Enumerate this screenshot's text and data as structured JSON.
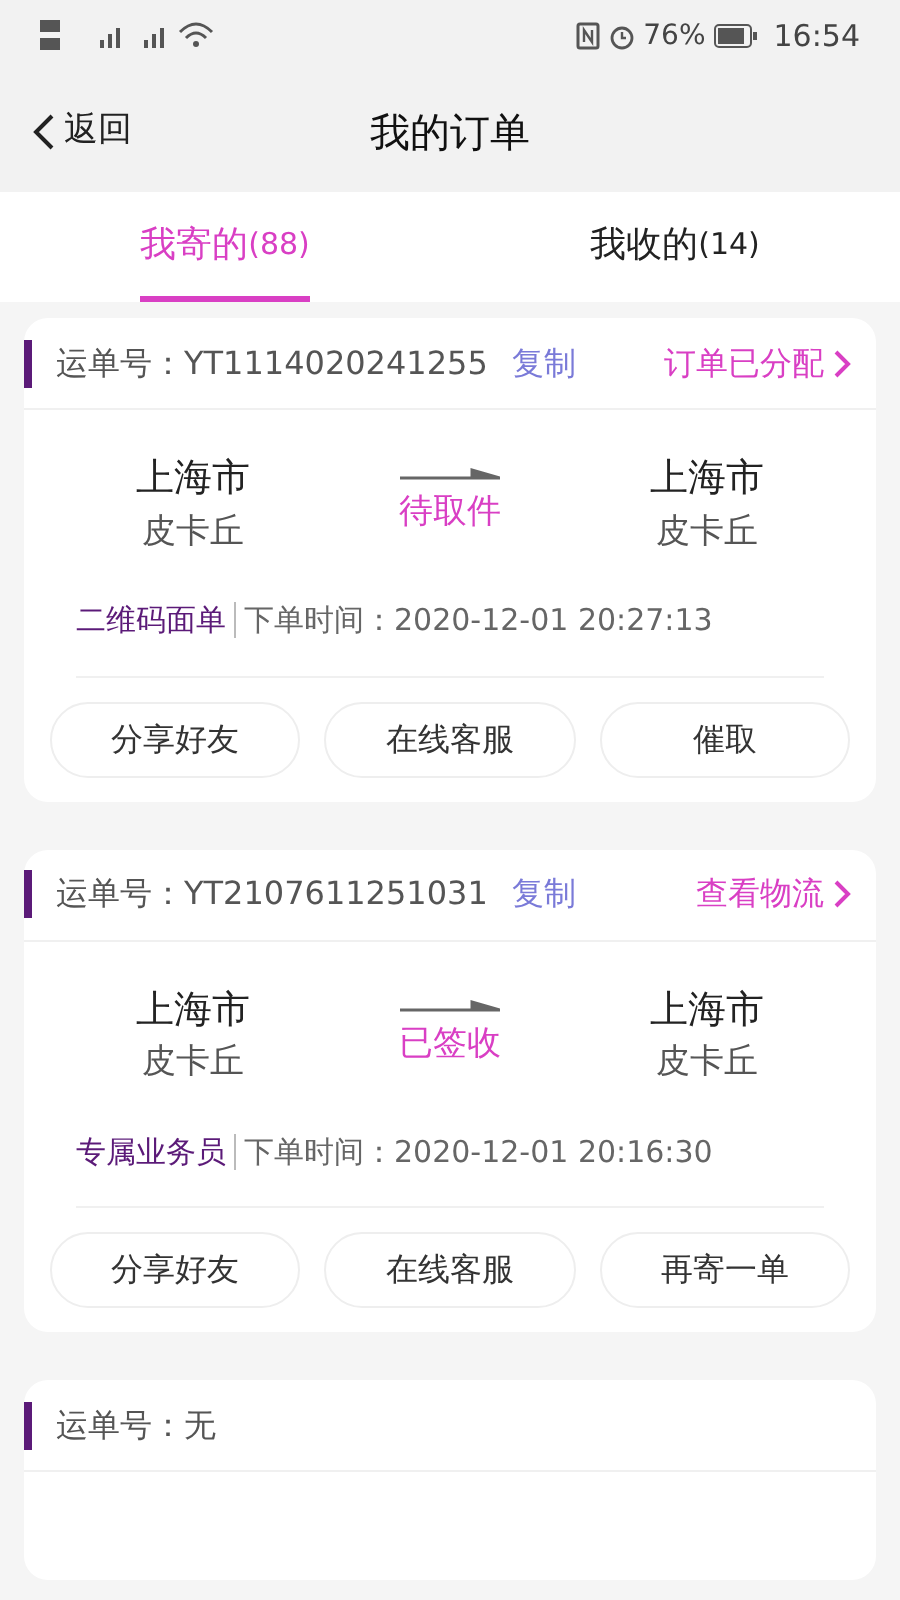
{
  "status_bar": {
    "battery_text": "76%",
    "time": "16:54"
  },
  "nav": {
    "back": "返回",
    "title": "我的订单"
  },
  "tabs": [
    {
      "label": "我寄的",
      "count": "(88)",
      "selected": true
    },
    {
      "label": "我收的",
      "count": "(14)",
      "selected": false
    }
  ],
  "orders": [
    {
      "waybill": "运单号：YT1114020241255",
      "copy": "复制",
      "action": "订单已分配",
      "from_city": "上海市",
      "from_name": "皮卡丘",
      "status": "待取件",
      "to_city": "上海市",
      "to_name": "皮卡丘",
      "tag": "二维码面单",
      "time": "下单时间：2020-12-01 20:27:13",
      "buttons": [
        "分享好友",
        "在线客服",
        "催取"
      ]
    },
    {
      "waybill": "运单号：YT2107611251031",
      "copy": "复制",
      "action": "查看物流",
      "from_city": "上海市",
      "from_name": "皮卡丘",
      "status": "已签收",
      "to_city": "上海市",
      "to_name": "皮卡丘",
      "tag": "专属业务员",
      "time": "下单时间：2020-12-01 20:16:30",
      "buttons": [
        "分享好友",
        "在线客服",
        "再寄一单"
      ]
    },
    {
      "waybill": "运单号：无"
    }
  ]
}
